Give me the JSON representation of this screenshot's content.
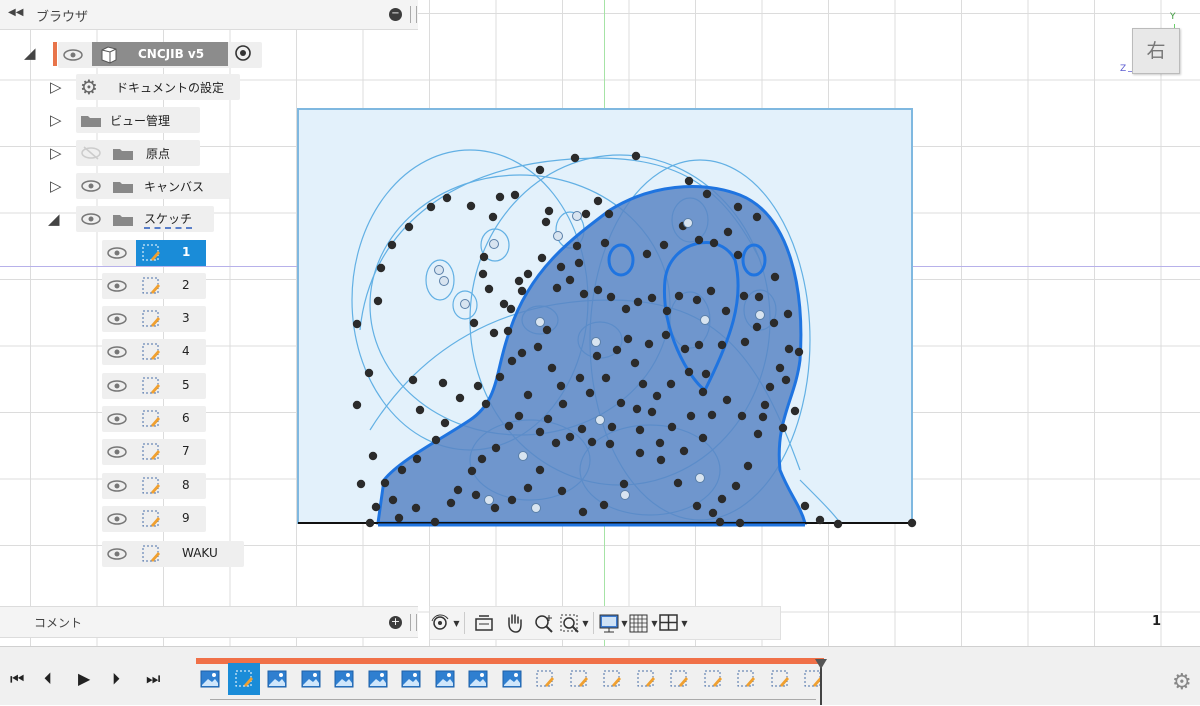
{
  "browser": {
    "collapse_icon": "double-chevron-left-icon",
    "title": "ブラウザ",
    "root": {
      "name": "CNCJIB v5"
    },
    "items": [
      {
        "label": "ドキュメントの設定",
        "icon": "gear-icon"
      },
      {
        "label": "ビュー管理",
        "icon": "folder-icon"
      },
      {
        "label": "原点",
        "icon": "folder-icon",
        "visibility": "hidden"
      },
      {
        "label": "キャンバス",
        "icon": "folder-icon"
      },
      {
        "label": "スケッチ",
        "icon": "folder-icon"
      }
    ],
    "sketches": [
      "1",
      "2",
      "3",
      "4",
      "5",
      "6",
      "7",
      "8",
      "9",
      "WAKU"
    ],
    "selected_sketch": "1"
  },
  "comment": {
    "title": "コメント"
  },
  "viewcube": {
    "face": "右",
    "axis_y": "Y",
    "axis_z": "Z"
  },
  "status": {
    "count": "1"
  },
  "navbar": {
    "tools": [
      "orbit-icon",
      "look-at-icon",
      "pan-hand-icon",
      "zoom-icon",
      "fit-icon",
      "display-settings-icon",
      "grid-settings-icon",
      "viewports-icon"
    ]
  },
  "timeline": {
    "controls": [
      "skip-start-icon",
      "step-back-icon",
      "play-icon",
      "step-forward-icon",
      "skip-end-icon"
    ],
    "items": [
      "canvas",
      "sketch",
      "canvas",
      "canvas",
      "canvas",
      "canvas",
      "canvas",
      "canvas",
      "canvas",
      "canvas",
      "sketch",
      "sketch",
      "sketch",
      "sketch",
      "sketch",
      "sketch",
      "sketch",
      "sketch",
      "sketch"
    ],
    "active_index": 1
  },
  "colors": {
    "accent": "#1a8cd8",
    "timeline_bar": "#f07048",
    "profile_fill": "#5b86c4",
    "profile_stroke": "#1f74e0"
  }
}
